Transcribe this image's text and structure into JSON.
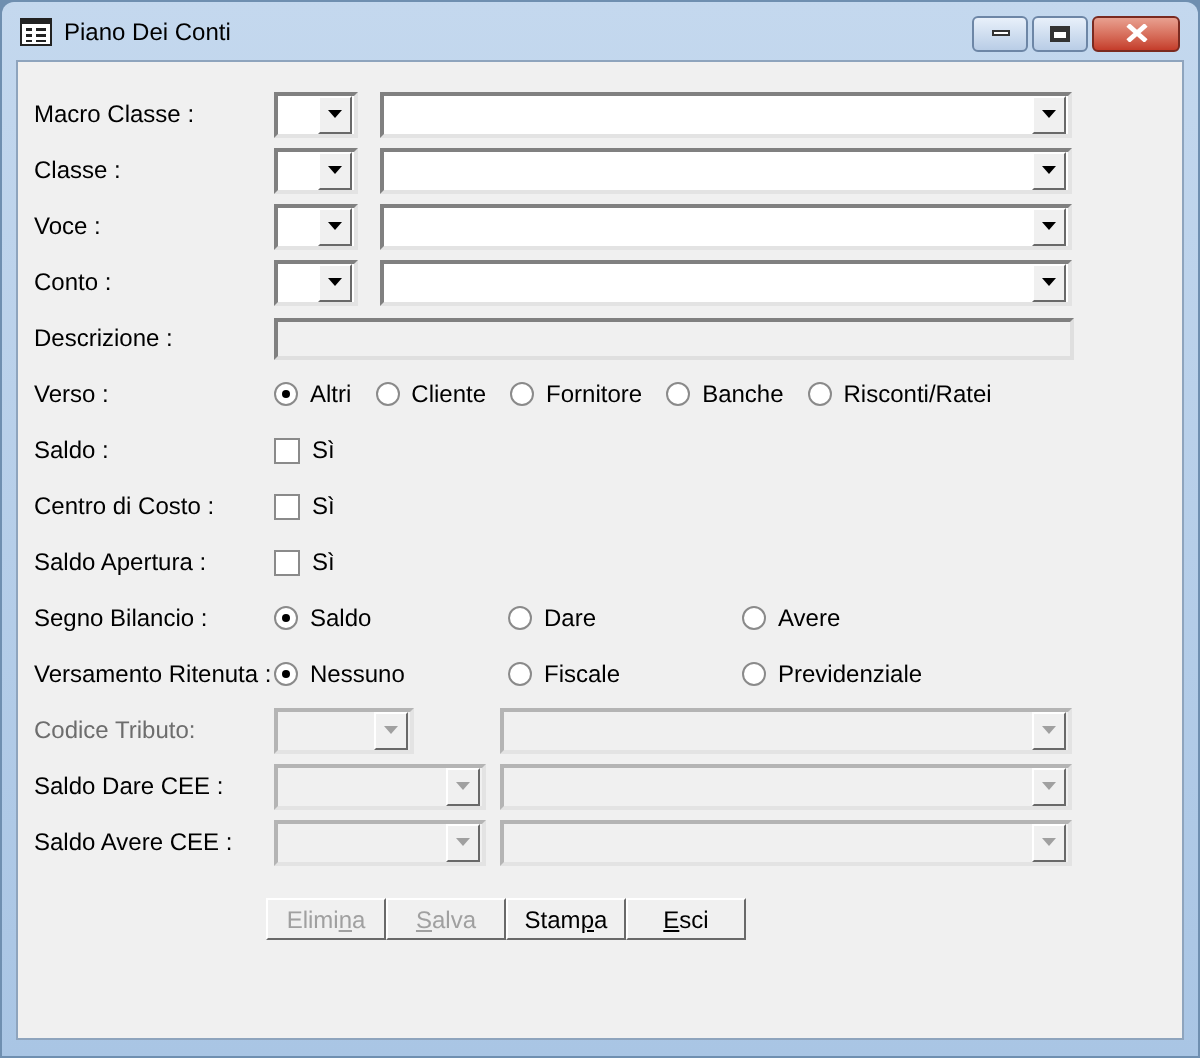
{
  "window": {
    "title": "Piano Dei Conti"
  },
  "fields": [
    {
      "kind": "short_combo_pair",
      "label": "Macro Classe :",
      "disabled": false
    },
    {
      "kind": "short_combo_pair",
      "label": "Classe :",
      "disabled": false
    },
    {
      "kind": "short_combo_pair",
      "label": "Voce :",
      "disabled": false
    },
    {
      "kind": "short_combo_pair",
      "label": "Conto :",
      "disabled": false
    },
    {
      "kind": "text",
      "label": "Descrizione :",
      "disabled": true
    },
    {
      "kind": "radio_inline",
      "label": "Verso :",
      "options": [
        {
          "label": "Altri",
          "selected": true
        },
        {
          "label": "Cliente",
          "selected": false
        },
        {
          "label": "Fornitore",
          "selected": false
        },
        {
          "label": "Banche",
          "selected": false
        },
        {
          "label": "Risconti/Ratei",
          "selected": false
        }
      ]
    },
    {
      "kind": "check",
      "label": "Saldo :",
      "option": "Sì",
      "checked": false
    },
    {
      "kind": "check",
      "label": "Centro di Costo :",
      "option": "Sì",
      "checked": false
    },
    {
      "kind": "check",
      "label": "Saldo Apertura :",
      "option": "Sì",
      "checked": false
    },
    {
      "kind": "radio_grid",
      "label": "Segno Bilancio :",
      "options": [
        {
          "label": "Saldo",
          "selected": true
        },
        {
          "label": "Dare",
          "selected": false
        },
        {
          "label": "Avere",
          "selected": false
        }
      ]
    },
    {
      "kind": "radio_grid",
      "label": "Versamento Ritenuta :",
      "options": [
        {
          "label": "Nessuno",
          "selected": true
        },
        {
          "label": "Fiscale",
          "selected": false
        },
        {
          "label": "Previdenziale",
          "selected": false
        }
      ]
    },
    {
      "kind": "code_combo_pair",
      "label": "Codice Tributo:",
      "disabled": true
    },
    {
      "kind": "cee_combo_pair",
      "label": "Saldo Dare CEE :",
      "disabled": true
    },
    {
      "kind": "cee_combo_pair",
      "label": "Saldo Avere CEE :",
      "disabled": true
    }
  ],
  "buttons": [
    {
      "before": "Elimi",
      "key": "n",
      "after": "a",
      "disabled": true
    },
    {
      "key": "S",
      "after": "alva",
      "disabled": true
    },
    {
      "before": "Stam",
      "key": "p",
      "after": "a",
      "disabled": false
    },
    {
      "key": "E",
      "after": "sci",
      "disabled": false
    }
  ]
}
